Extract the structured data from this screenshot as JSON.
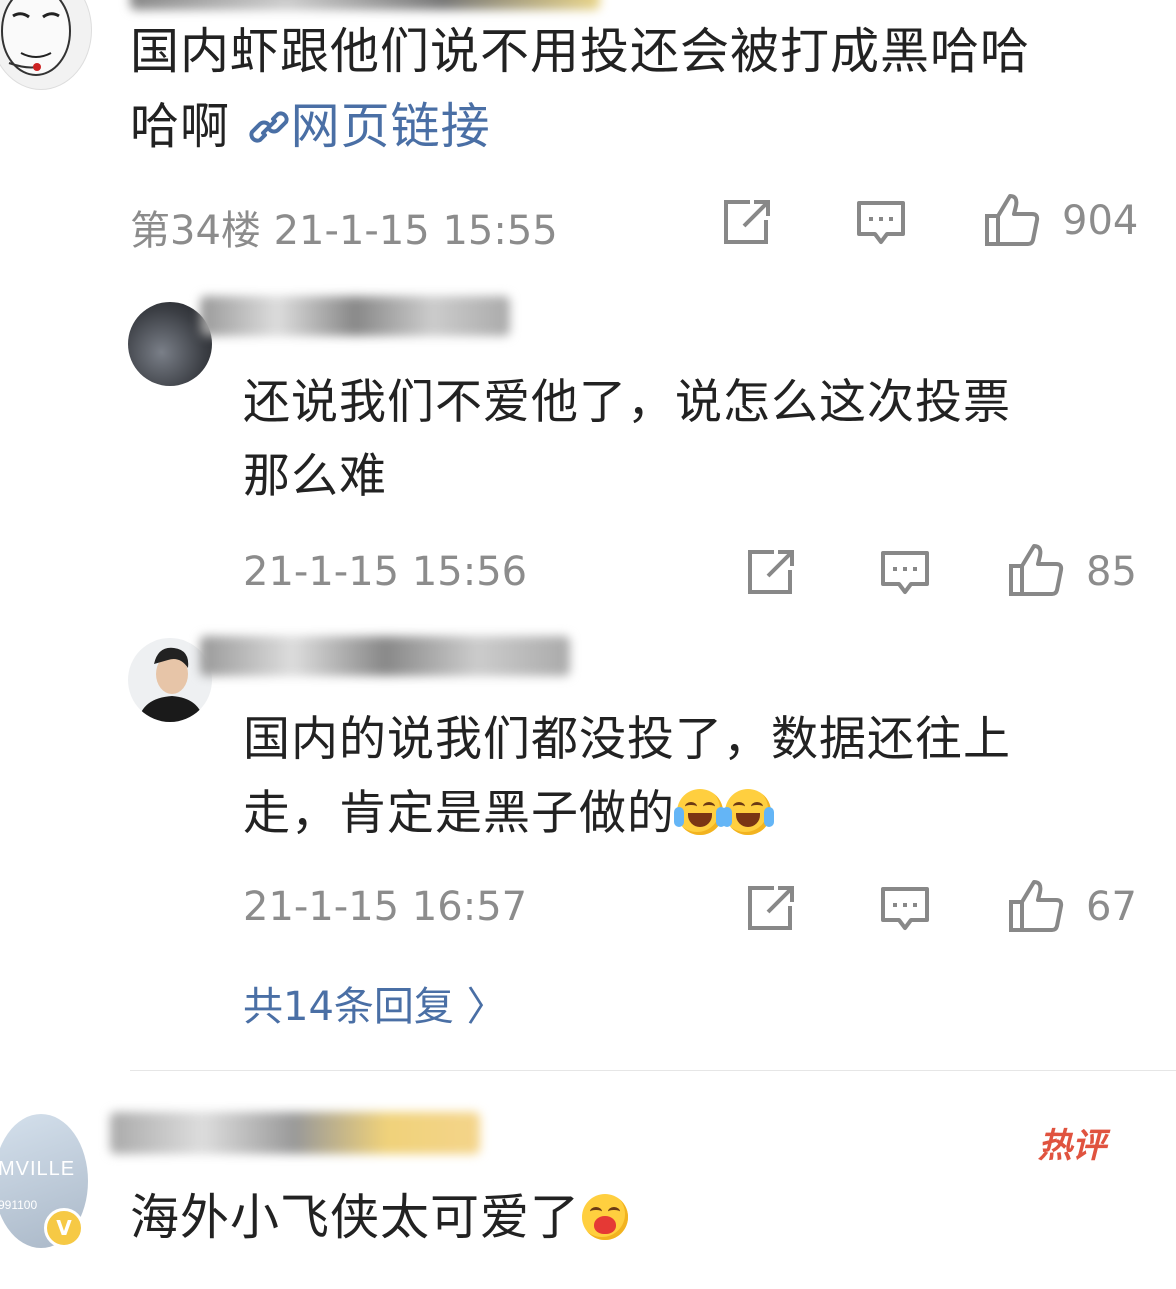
{
  "comment_main": {
    "text_line1": "国内虾跟他们说不用投还会被打成黑哈哈",
    "text_line2": "哈啊",
    "link_label": "网页链接",
    "floor_time": "第34楼 21-1-15 15:55",
    "like_count": "904"
  },
  "replies": [
    {
      "text_line1": "还说我们不爱他了，说怎么这次投票",
      "text_line2": "那么难",
      "time": "21-1-15 15:56",
      "like_count": "85"
    },
    {
      "text_line1": "国内的说我们都没投了，数据还往上",
      "text_line2": "走，肯定是黑子做的",
      "time": "21-1-15 16:57",
      "like_count": "67"
    }
  ],
  "more_replies": "共14条回复 〉",
  "comment_next": {
    "avatar_text": "MVILLE",
    "avatar_subtext": "991100",
    "verified_badge": "V",
    "hot_badge": "热评",
    "text": "海外小飞侠太可爱了"
  },
  "icons": [
    "share-icon",
    "comment-icon",
    "like-icon",
    "link-icon",
    "chevron-right-icon",
    "verified-icon"
  ],
  "colors": {
    "link": "#4a6fa5",
    "meta": "#8c8c8c",
    "hot": "#e0533f",
    "emoji": "#ffcf3f"
  }
}
